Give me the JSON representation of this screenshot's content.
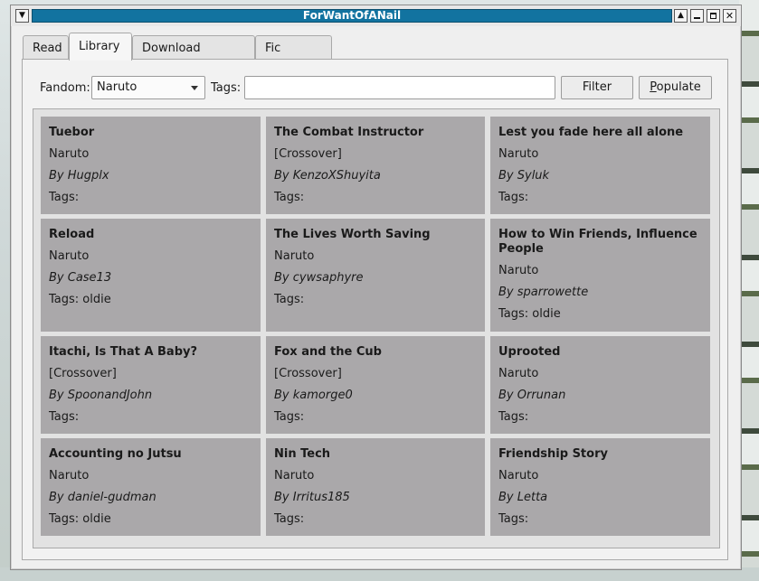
{
  "window": {
    "title": "ForWantOfANail"
  },
  "tabs": [
    "Read",
    "Library",
    "Download Manager",
    "Fic Details"
  ],
  "filter": {
    "fandom_label": "Fandom:",
    "fandom_value": "Naruto",
    "tags_label": "Tags:",
    "tags_value": "",
    "filter_button": "Filter",
    "populate_button": "Populate"
  },
  "cards": [
    {
      "title": "Tuebor",
      "fandom": "Naruto",
      "author": "By Hugplx",
      "tags": "Tags:"
    },
    {
      "title": "The Combat Instructor",
      "fandom": "[Crossover]",
      "author": "By KenzoXShuyita",
      "tags": "Tags:"
    },
    {
      "title": "Lest you fade here all alone",
      "fandom": "Naruto",
      "author": "By Syluk",
      "tags": "Tags:"
    },
    {
      "title": "Reload",
      "fandom": "Naruto",
      "author": "By Case13",
      "tags": "Tags: oldie"
    },
    {
      "title": "The Lives Worth Saving",
      "fandom": "Naruto",
      "author": "By cywsaphyre",
      "tags": "Tags:"
    },
    {
      "title": "How to Win Friends, Influence People",
      "fandom": "Naruto",
      "author": "By sparrowette",
      "tags": "Tags: oldie"
    },
    {
      "title": "Itachi, Is That A Baby?",
      "fandom": "[Crossover]",
      "author": "By SpoonandJohn",
      "tags": "Tags:"
    },
    {
      "title": "Fox and the Cub",
      "fandom": "[Crossover]",
      "author": "By kamorge0",
      "tags": "Tags:"
    },
    {
      "title": "Uprooted",
      "fandom": "Naruto",
      "author": "By Orrunan",
      "tags": "Tags:"
    },
    {
      "title": "Accounting no Jutsu",
      "fandom": "Naruto",
      "author": "By daniel-gudman",
      "tags": "Tags: oldie"
    },
    {
      "title": "Nin Tech",
      "fandom": "Naruto",
      "author": "By Irritus185",
      "tags": "Tags:"
    },
    {
      "title": "Friendship Story",
      "fandom": "Naruto",
      "author": "By Letta",
      "tags": "Tags:"
    }
  ],
  "icons": {
    "menu": "chevron-down-icon",
    "shade": "triangle-up-icon",
    "minimize": "minimize-icon",
    "maximize": "maximize-icon",
    "close": "close-icon"
  },
  "colors": {
    "title_bar": "#1273a0",
    "card_bg": "#aaa8aa"
  }
}
